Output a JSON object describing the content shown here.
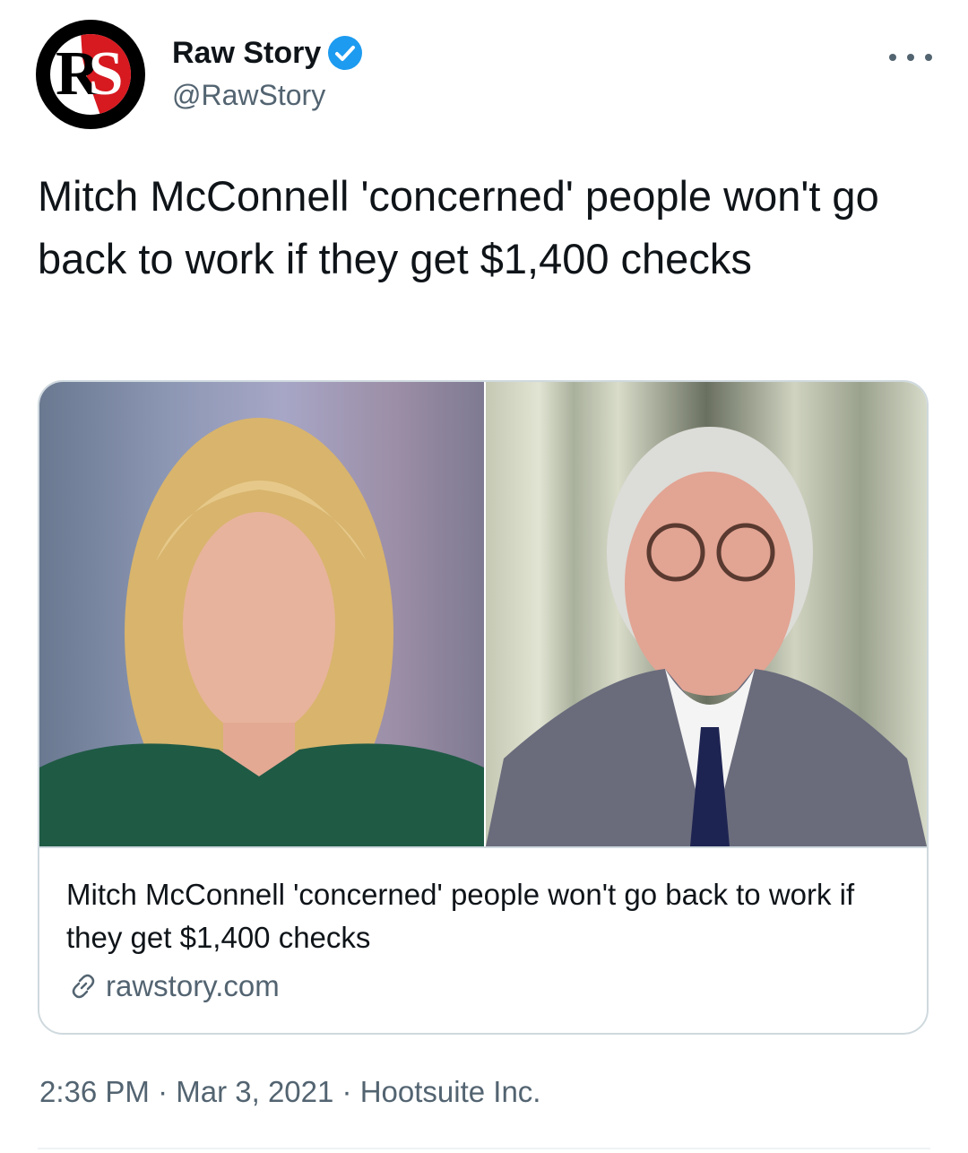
{
  "author": {
    "display_name": "Raw Story",
    "handle": "@RawStory",
    "avatar_text": "RS",
    "verified": true,
    "verified_color": "#1d9bf0"
  },
  "menu": {
    "icon": "more-horizontal-icon"
  },
  "tweet": {
    "text": "Mitch McConnell 'concerned' people won't go back to work if they get $1,400 checks"
  },
  "card": {
    "title": "Mitch McConnell 'concerned' people won't go back to work if they get $1,400 checks",
    "domain": "rawstory.com",
    "link_icon": "link-icon"
  },
  "meta": {
    "time": "2:36 PM",
    "date": "Mar 3, 2021",
    "source": "Hootsuite Inc.",
    "separator": "·"
  }
}
